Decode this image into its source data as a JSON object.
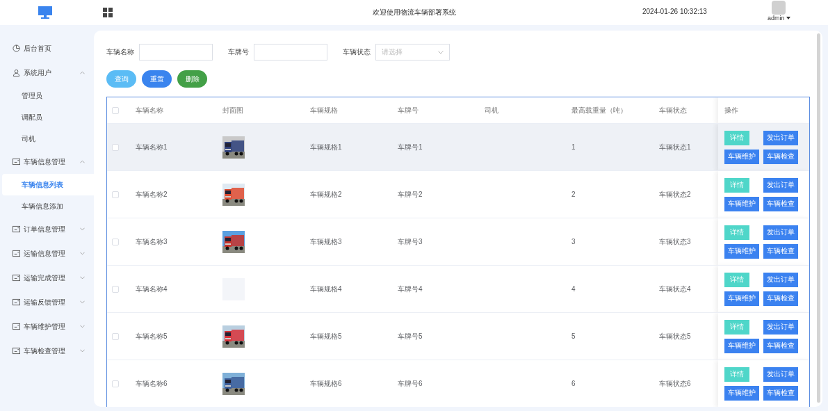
{
  "header": {
    "title": "欢迎使用物流车辆部署系统",
    "datetime": "2024-01-26 10:32:13",
    "user": "admin"
  },
  "sidebar": {
    "items": [
      {
        "kind": "link",
        "label": "后台首页",
        "selected": false
      },
      {
        "kind": "user-group",
        "label": "系统用户",
        "expanded": true,
        "children": [
          {
            "label": "管理员",
            "selected": false
          },
          {
            "label": "调配员",
            "selected": false
          },
          {
            "label": "司机",
            "selected": false
          }
        ]
      },
      {
        "kind": "group",
        "label": "车辆信息管理",
        "expanded": true,
        "children": [
          {
            "label": "车辆信息列表",
            "selected": true
          },
          {
            "label": "车辆信息添加",
            "selected": false
          }
        ]
      },
      {
        "kind": "group",
        "label": "订单信息管理",
        "expanded": false
      },
      {
        "kind": "group",
        "label": "运输信息管理",
        "expanded": false
      },
      {
        "kind": "group",
        "label": "运输完成管理",
        "expanded": false
      },
      {
        "kind": "group",
        "label": "运输反馈管理",
        "expanded": false
      },
      {
        "kind": "group",
        "label": "车辆维护管理",
        "expanded": false
      },
      {
        "kind": "group",
        "label": "车辆检查管理",
        "expanded": false
      }
    ]
  },
  "filters": [
    {
      "kind": "text",
      "label": "车辆名称"
    },
    {
      "kind": "text",
      "label": "车牌号"
    },
    {
      "kind": "select",
      "label": "车辆状态",
      "placeholder": "请选择"
    }
  ],
  "buttons": [
    {
      "kind": "search",
      "label": "查询"
    },
    {
      "kind": "reset",
      "label": "重置"
    },
    {
      "kind": "delete",
      "label": "删除"
    }
  ],
  "table": {
    "all_checked": false,
    "columns": [
      "车辆名称",
      "封面图",
      "车辆规格",
      "车牌号",
      "司机",
      "最高载重量（吨）",
      "车辆状态",
      "操作"
    ],
    "rows": [
      {
        "checked": false,
        "hovered": true,
        "name": "车辆名称1",
        "spec": "车辆规格1",
        "plate": "车牌号1",
        "load": "1",
        "status": "车辆状态1",
        "actions": [
          {
            "kind": "detail",
            "label": "详情"
          },
          {
            "kind": "primary",
            "label": "发出订单"
          },
          {
            "kind": "primary",
            "label": "车辆维护"
          },
          {
            "kind": "primary",
            "label": "车辆检查"
          }
        ]
      },
      {
        "checked": false,
        "hovered": false,
        "name": "车辆名称2",
        "spec": "车辆规格2",
        "plate": "车牌号2",
        "load": "2",
        "status": "车辆状态2",
        "actions": [
          {
            "kind": "detail",
            "label": "详情"
          },
          {
            "kind": "primary",
            "label": "发出订单"
          },
          {
            "kind": "primary",
            "label": "车辆维护"
          },
          {
            "kind": "primary",
            "label": "车辆检查"
          }
        ]
      },
      {
        "checked": false,
        "hovered": false,
        "name": "车辆名称3",
        "spec": "车辆规格3",
        "plate": "车牌号3",
        "load": "3",
        "status": "车辆状态3",
        "actions": [
          {
            "kind": "detail",
            "label": "详情"
          },
          {
            "kind": "primary",
            "label": "发出订单"
          },
          {
            "kind": "primary",
            "label": "车辆维护"
          },
          {
            "kind": "primary",
            "label": "车辆检查"
          }
        ]
      },
      {
        "checked": false,
        "hovered": false,
        "name": "车辆名称4",
        "cover": {
          "kind": "blank"
        },
        "spec": "车辆规格4",
        "plate": "车牌号4",
        "load": "4",
        "status": "车辆状态4",
        "actions": [
          {
            "kind": "detail",
            "label": "详情"
          },
          {
            "kind": "primary",
            "label": "发出订单"
          },
          {
            "kind": "primary",
            "label": "车辆维护"
          },
          {
            "kind": "primary",
            "label": "车辆检查"
          }
        ]
      },
      {
        "checked": false,
        "hovered": false,
        "name": "车辆名称5",
        "spec": "车辆规格5",
        "plate": "车牌号5",
        "load": "5",
        "status": "车辆状态5",
        "actions": [
          {
            "kind": "detail",
            "label": "详情"
          },
          {
            "kind": "primary",
            "label": "发出订单"
          },
          {
            "kind": "primary",
            "label": "车辆维护"
          },
          {
            "kind": "primary",
            "label": "车辆检查"
          }
        ]
      },
      {
        "checked": false,
        "hovered": false,
        "name": "车辆名称6",
        "spec": "车辆规格6",
        "plate": "车牌号6",
        "load": "6",
        "status": "车辆状态6",
        "actions": [
          {
            "kind": "detail",
            "label": "详情"
          },
          {
            "kind": "primary",
            "label": "发出订单"
          },
          {
            "kind": "primary",
            "label": "车辆维护"
          },
          {
            "kind": "primary",
            "label": "车辆检查"
          }
        ]
      }
    ]
  }
}
